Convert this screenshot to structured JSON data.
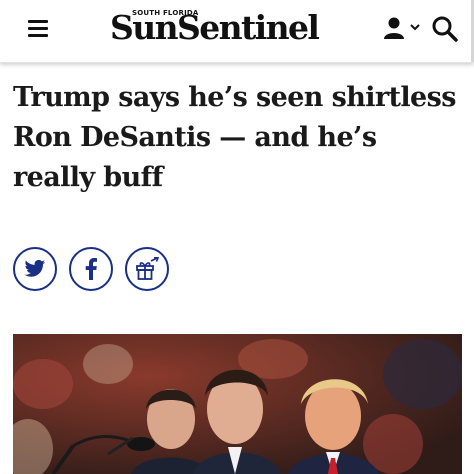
{
  "header": {
    "brand_top": "SOUTH FLORIDA",
    "brand_name": "SunSentinel",
    "menu_icon": "hamburger-menu-icon",
    "account_icon": "user-icon",
    "account_caret_icon": "chevron-down-icon",
    "search_icon": "search-icon"
  },
  "article": {
    "headline": "Trump says he’s seen shirtless Ron DeSantis — and he’s really buff",
    "share_buttons": [
      {
        "icon": "twitter-icon"
      },
      {
        "icon": "facebook-icon"
      },
      {
        "icon": "gift-icon"
      }
    ],
    "hero_image": "photo-of-three-men-at-rally"
  },
  "colors": {
    "share_ring": "#1a2f86",
    "text": "#1a1a1a",
    "header_bg": "#ffffff"
  }
}
